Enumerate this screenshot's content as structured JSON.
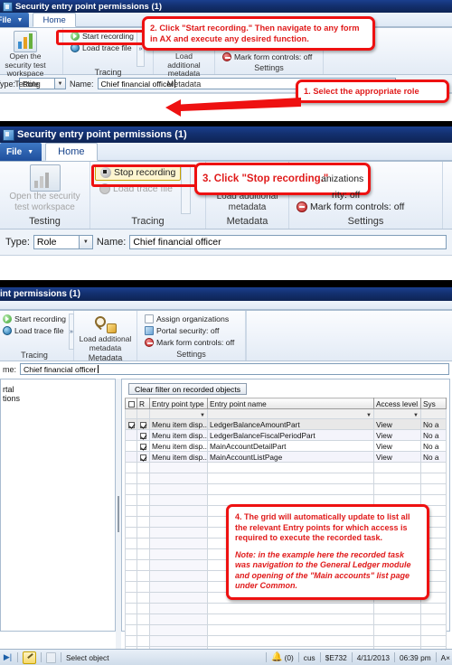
{
  "window1": {
    "title": "Security entry point permissions (1)",
    "file_tab": "File",
    "home_tab": "Home",
    "groups": {
      "testing": {
        "label": "Testing",
        "button": "Open the security test workspace"
      },
      "tracing": {
        "label": "Tracing",
        "start": "Start recording",
        "load_trace": "Load trace file",
        "expander": "»"
      },
      "metadata": {
        "label": "Metadata",
        "button": "Load additional metadata"
      },
      "settings": {
        "label": "Settings",
        "mark_form_controls": "Mark form controls: off"
      }
    },
    "form": {
      "type_label": "Type:",
      "type_value": "Role",
      "name_label": "Name:",
      "name_value": "Chief financial officer"
    },
    "callouts": {
      "step2": "2. Click \"Start recording.\" Then navigate to any form in AX and execute any desired function.",
      "step1": "1. Select the appropriate role"
    }
  },
  "window2": {
    "title": "Security entry point permissions (1)",
    "file_tab": "File",
    "home_tab": "Home",
    "groups": {
      "testing": {
        "label": "Testing",
        "button": "Open the security test workspace"
      },
      "tracing": {
        "label": "Tracing",
        "stop": "Stop recording",
        "load_trace": "Load trace file"
      },
      "metadata": {
        "label": "Metadata",
        "button": "Load additional metadata"
      },
      "settings": {
        "label": "Settings",
        "assign_organizations": "anizations",
        "portal_security": "rity: off",
        "mark_form_controls": "Mark form controls: off"
      }
    },
    "form": {
      "type_label": "Type:",
      "type_value": "Role",
      "name_label": "Name:",
      "name_value": "Chief financial officer"
    },
    "callouts": {
      "step3": "3. Click \"Stop recording.\""
    }
  },
  "window3": {
    "title": "int permissions (1)",
    "groups": {
      "tracing": {
        "label": "Tracing",
        "start": "Start recording",
        "load_trace": "Load trace file",
        "expander": "»"
      },
      "metadata": {
        "label": "Metadata",
        "button": "Load additional metadata"
      },
      "settings": {
        "label": "Settings",
        "assign_organizations": "Assign organizations",
        "portal_security": "Portal security: off",
        "mark_form_controls": "Mark form controls: off"
      }
    },
    "form": {
      "name_label": "me:",
      "name_value": "Chief financial officer"
    },
    "tree": {
      "item1": "rtal",
      "item2": "tions"
    },
    "grid": {
      "clear_filter": "Clear filter on recorded objects",
      "columns": [
        "",
        "R",
        "Entry point type",
        "Entry point name",
        "Access level",
        "Sys"
      ],
      "rows": [
        {
          "checked": true,
          "r": true,
          "type": "Menu item disp...",
          "name": "LedgerBalanceAmountPart",
          "access": "View",
          "sys": "No a"
        },
        {
          "checked": false,
          "r": true,
          "type": "Menu item disp...",
          "name": "LedgerBalanceFiscalPeriodPart",
          "access": "View",
          "sys": "No a"
        },
        {
          "checked": false,
          "r": true,
          "type": "Menu item disp...",
          "name": "MainAccountDetailPart",
          "access": "View",
          "sys": "No a"
        },
        {
          "checked": false,
          "r": true,
          "type": "Menu item disp...",
          "name": "MainAccountListPage",
          "access": "View",
          "sys": "No a"
        }
      ]
    },
    "callouts": {
      "step4": "4. The grid will automatically update to list all the relevant Entry points for which access is required to execute the recorded task.",
      "step4_note": "Note: in the example here the recorded task was navigation to the General Ledger module and opening of the \"Main accounts\" list page under Common."
    }
  },
  "statusbar": {
    "select_object": "Select object",
    "notifications": "(0)",
    "company": "cus",
    "session": "$E732",
    "date": "4/11/2013",
    "time": "06:39 pm",
    "product": "A×"
  },
  "colors": {
    "callout_red": "#ee1111",
    "callout_text": "#e01b1b",
    "title_blue": "#13306f",
    "ribbon_bg": "#eef3fa"
  }
}
